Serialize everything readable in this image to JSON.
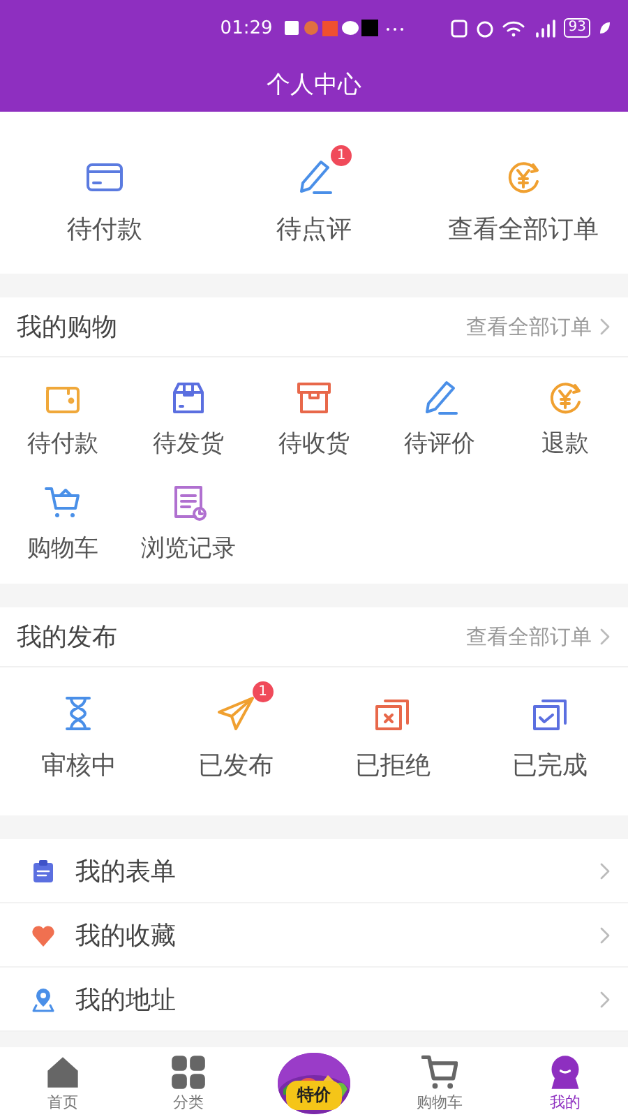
{
  "status_bar": {
    "time": "01:29",
    "battery": "93"
  },
  "header": {
    "title": "个人中心"
  },
  "sections": [
    {
      "items": [
        {
          "label": "待付款"
        },
        {
          "label": "待点评",
          "badge": "1"
        },
        {
          "label": "查看全部订单"
        }
      ]
    },
    {
      "title": "我的购物",
      "link": "查看全部订单",
      "items": [
        {
          "label": "待付款"
        },
        {
          "label": "待发货"
        },
        {
          "label": "待收货"
        },
        {
          "label": "待评价"
        },
        {
          "label": "退款"
        },
        {
          "label": "购物车"
        },
        {
          "label": "浏览记录"
        }
      ]
    },
    {
      "title": "我的发布",
      "link": "查看全部订单",
      "items": [
        {
          "label": "审核中"
        },
        {
          "label": "已发布",
          "badge": "1"
        },
        {
          "label": "已拒绝"
        },
        {
          "label": "已完成"
        }
      ]
    }
  ],
  "menu": [
    {
      "label": "我的表单"
    },
    {
      "label": "我的收藏"
    },
    {
      "label": "我的地址"
    }
  ],
  "tab_bar": [
    {
      "kind": "tab",
      "label": "首页",
      "selected": false
    },
    {
      "kind": "tab",
      "label": "分类",
      "selected": false
    },
    {
      "kind": "promo",
      "label": "特价",
      "selected": false
    },
    {
      "kind": "tab",
      "label": "购物车",
      "selected": false
    },
    {
      "kind": "tab",
      "label": "我的",
      "selected": true
    }
  ]
}
